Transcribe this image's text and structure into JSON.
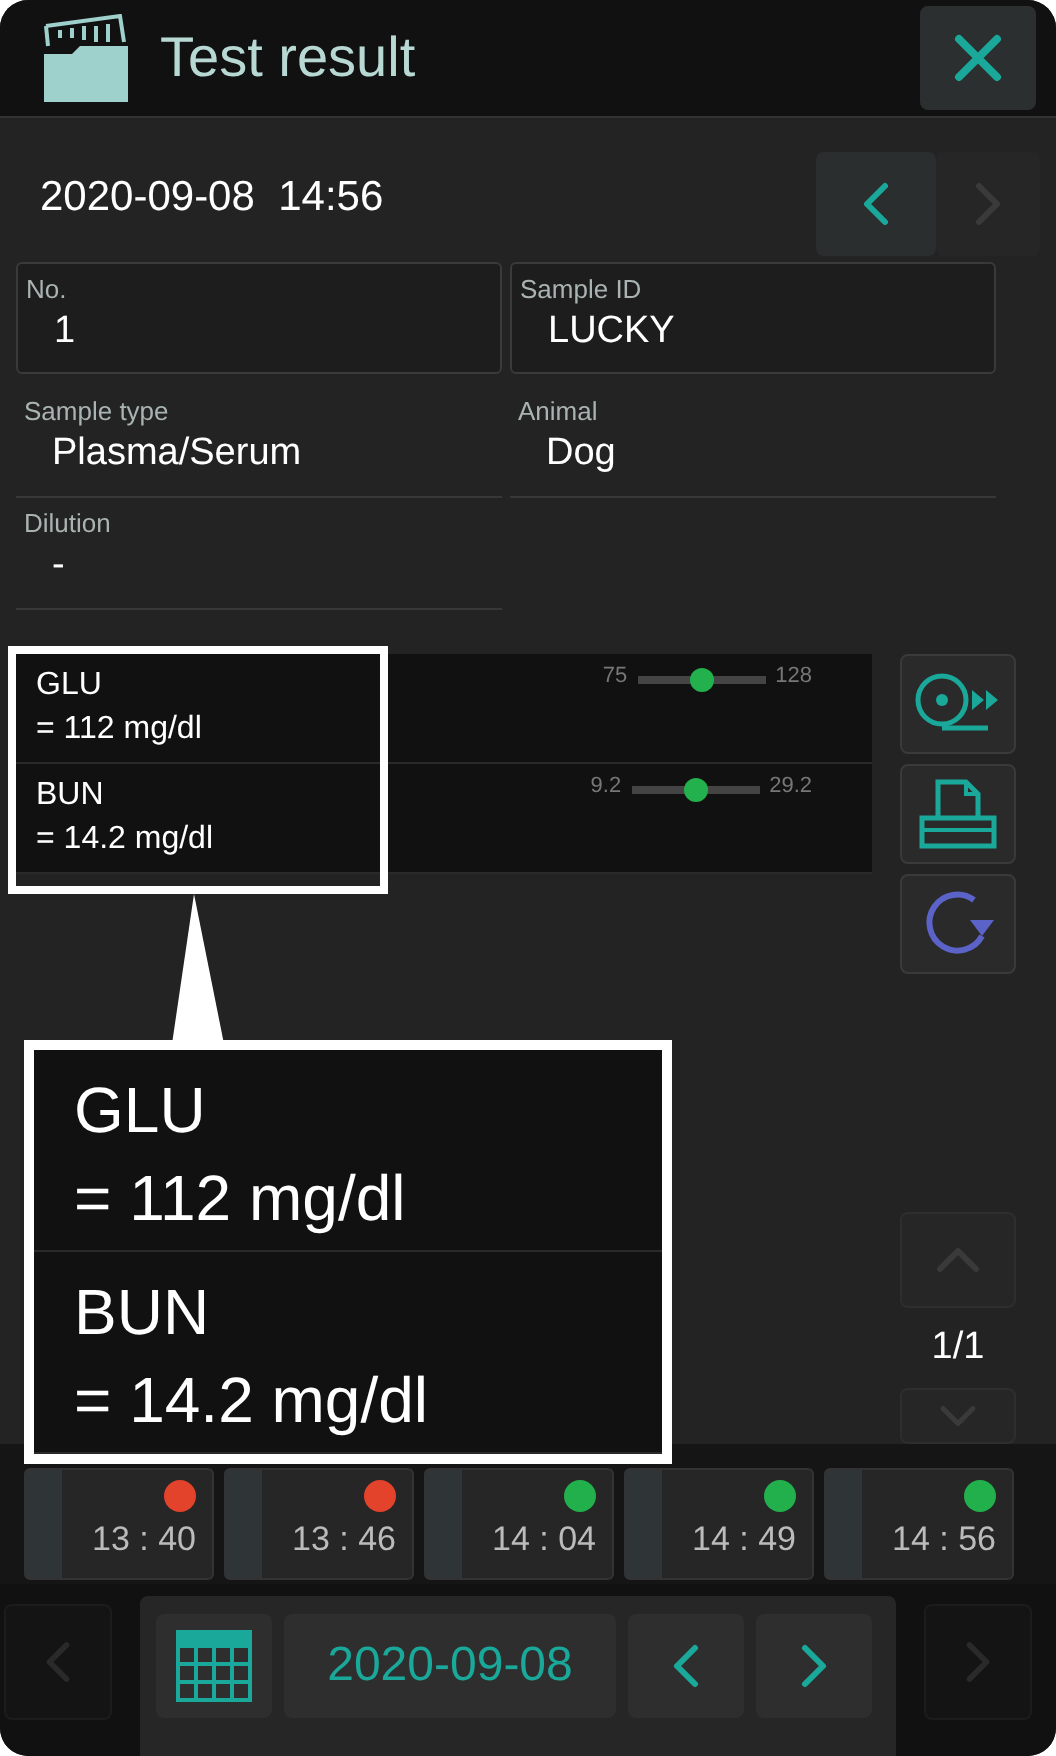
{
  "window": {
    "title": "Test result"
  },
  "record": {
    "datetime": "2020-09-08  14:56",
    "prev_enabled": true,
    "next_enabled": false
  },
  "fields": [
    {
      "label": "No.",
      "value": "1",
      "kind": "boxed"
    },
    {
      "label": "Sample ID",
      "value": "LUCKY",
      "kind": "boxed"
    },
    {
      "label": "Sample type",
      "value": "Plasma/Serum",
      "kind": "plain"
    },
    {
      "label": "Animal",
      "value": "Dog",
      "kind": "plain"
    },
    {
      "label": "Dilution",
      "value": "-",
      "kind": "plain"
    }
  ],
  "results": [
    {
      "name": "GLU",
      "value": "= 112 mg/dl",
      "low": "75",
      "high": "128",
      "level": 0.5,
      "color": "#22b14c"
    },
    {
      "name": "BUN",
      "value": "= 14.2 mg/dl",
      "low": "9.2",
      "high": "29.2",
      "level": 0.5,
      "color": "#22b14c"
    }
  ],
  "callout": {
    "rows": [
      {
        "name": "GLU",
        "value": "= 112 mg/dl"
      },
      {
        "name": "BUN",
        "value": "= 14.2 mg/dl"
      }
    ]
  },
  "pager": {
    "page": "1/1",
    "up_enabled": false,
    "down_enabled": false
  },
  "timeline": [
    {
      "time": "13 : 40",
      "color": "#e3432b"
    },
    {
      "time": "13 : 46",
      "color": "#e3432b"
    },
    {
      "time": "14 : 04",
      "color": "#22b04c"
    },
    {
      "time": "14 : 49",
      "color": "#22b04c"
    },
    {
      "time": "14 : 56",
      "color": "#22b04c"
    }
  ],
  "date_bar": {
    "date": "2020-09-08",
    "outer_prev_enabled": false,
    "outer_next_enabled": false
  }
}
